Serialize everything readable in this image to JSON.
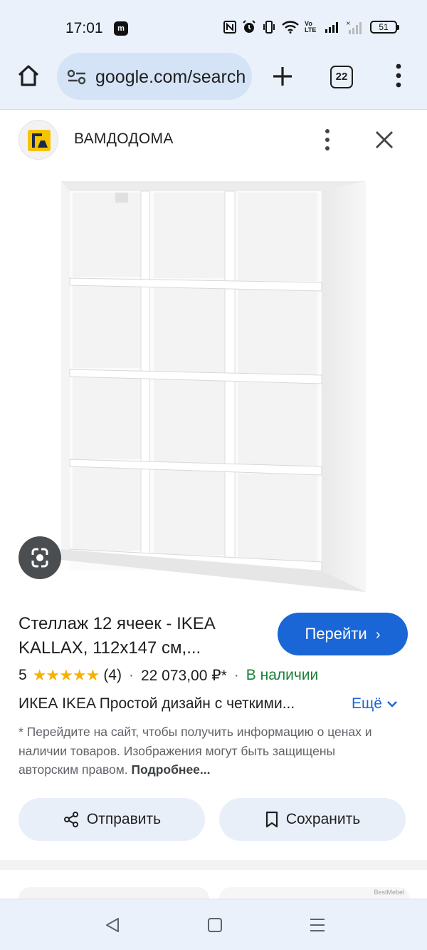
{
  "status_bar": {
    "time": "17:01",
    "app_badge": "m",
    "icons": [
      "nfc-icon",
      "alarm-icon",
      "vibrate-icon",
      "wifi-icon",
      "volte-icon",
      "signal-icon",
      "signal-2-icon"
    ],
    "volte_label": "Vo LTE",
    "battery": "51"
  },
  "browser": {
    "url": "google.com/search",
    "tab_count": "22"
  },
  "source": {
    "name": "ВАМДОДОМА"
  },
  "product": {
    "title": "Стеллаж 12 ячеек - IKEA KALLAX, 112x147 см,...",
    "go_button": "Перейти",
    "rating": "5",
    "stars": "★★★★★",
    "reviews": "(4)",
    "price": "22 073,00 ₽*",
    "availability": "В наличии",
    "description": "ИКЕА IKEA Простой дизайн с четкими...",
    "more_label": "Ещё",
    "disclaimer": "* Перейдите на сайт, чтобы получить информацию о ценах и наличии товаров. Изображения могут быть защищены авторским правом.",
    "disclaimer_link": "Подробнее..."
  },
  "actions": {
    "share": "Отправить",
    "save": "Сохранить"
  },
  "related": {
    "watermark": "BestMebel"
  },
  "colors": {
    "accent": "#1a66d6",
    "in_stock": "#188038",
    "star": "#f5b300",
    "chrome_bg": "#eaf1fb"
  }
}
